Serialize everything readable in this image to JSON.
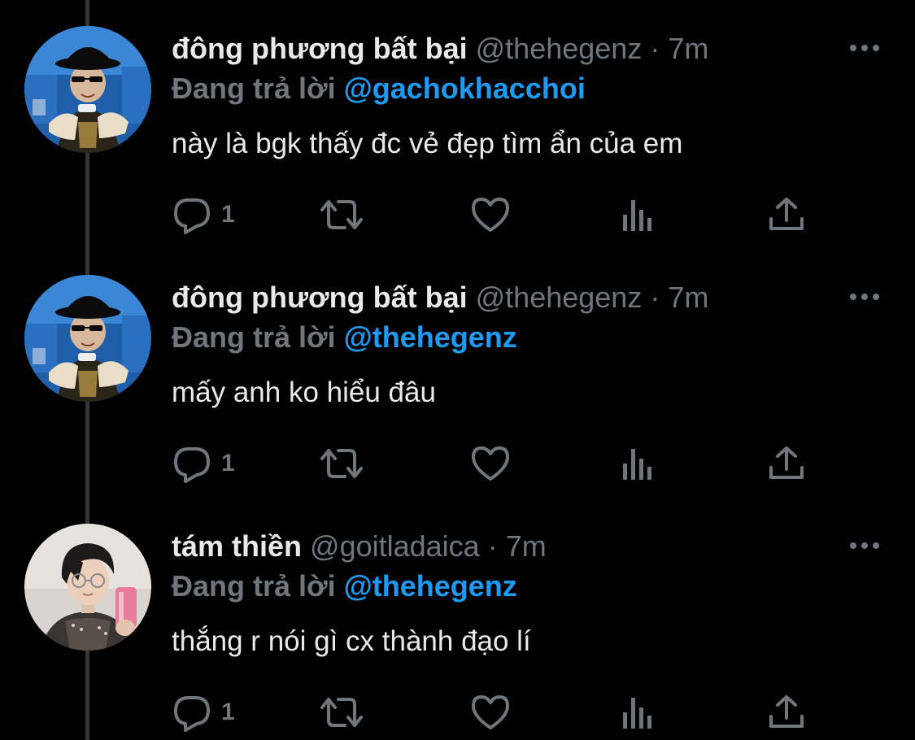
{
  "colors": {
    "background": "#000000",
    "primary_text": "#e7e9ea",
    "secondary_text": "#71767b",
    "accent": "#1d9bf0",
    "thread_line": "#333639"
  },
  "tweets": [
    {
      "display_name": "đông phương bất bại",
      "handle": "@thehegenz",
      "separator": "·",
      "time": "7m",
      "replying_label": "Đang trả lời",
      "replying_to": "@gachokhacchoi",
      "text": "này là bgk thấy đc vẻ đẹp tìm ẩn của em",
      "reply_count": "1",
      "avatar_icon": "avatar-performer",
      "icons": [
        "reply-icon",
        "retweet-icon",
        "like-icon",
        "views-icon",
        "share-icon"
      ]
    },
    {
      "display_name": "đông phương bất bại",
      "handle": "@thehegenz",
      "separator": "·",
      "time": "7m",
      "replying_label": "Đang trả lời",
      "replying_to": "@thehegenz",
      "text": "mấy anh ko hiểu đâu",
      "reply_count": "1",
      "avatar_icon": "avatar-performer",
      "icons": [
        "reply-icon",
        "retweet-icon",
        "like-icon",
        "views-icon",
        "share-icon"
      ]
    },
    {
      "display_name": "tám thiền",
      "handle": "@goitladaica",
      "separator": "·",
      "time": "7m",
      "replying_label": "Đang trả lời",
      "replying_to": "@thehegenz",
      "text": "thắng r nói gì cx thành đạo lí",
      "reply_count": "1",
      "avatar_icon": "avatar-selfie",
      "icons": [
        "reply-icon",
        "retweet-icon",
        "like-icon",
        "views-icon",
        "share-icon"
      ]
    }
  ]
}
